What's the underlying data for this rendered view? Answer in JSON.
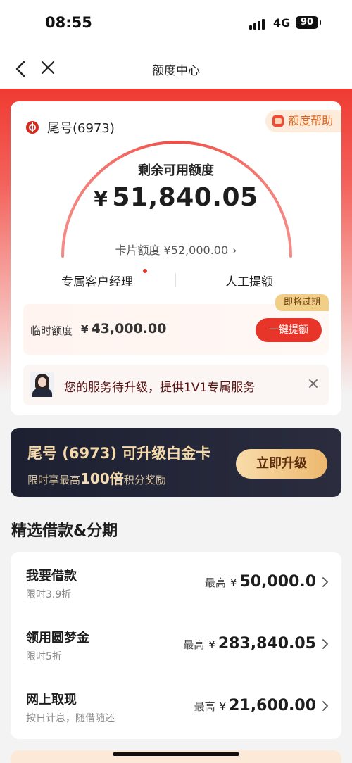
{
  "status_bar": {
    "time": "08:55",
    "network": "4G",
    "battery": "90"
  },
  "nav": {
    "title": "额度中心"
  },
  "card": {
    "tail_label": "尾号(6973)",
    "help_label": "额度帮助",
    "remaining_label": "剩余可用额度",
    "currency": "¥",
    "remaining_amount": "51,840.05",
    "card_limit_text": "卡片额度 ¥52,000.00",
    "links": [
      "专属客户经理",
      "人工提额"
    ],
    "temp_label": "临时额度",
    "temp_amount": "43,000.00",
    "temp_badge": "即将过期",
    "temp_button": "一键提额",
    "service_message": "您的服务待升级，提供1V1专属服务"
  },
  "upgrade": {
    "title": "尾号 (6973) 可升级白金卡",
    "subtitle_pre": "限时享最高",
    "subtitle_em": "100倍",
    "subtitle_post": "积分奖励",
    "button": "立即升级"
  },
  "section": {
    "title": "精选借款&分期",
    "items": [
      {
        "name": "我要借款",
        "sub": "限时3.9折",
        "prefix": "最高",
        "amount": "50,000.0"
      },
      {
        "name": "领用圆梦金",
        "sub": "限时5折",
        "prefix": "最高",
        "amount": "283,840.05"
      },
      {
        "name": "网上取现",
        "sub": "按日计息，随借随还",
        "prefix": "最高",
        "amount": "21,600.00"
      }
    ]
  },
  "colors": {
    "accent": "#e8352a",
    "gold": "#f5d9a8",
    "dark": "#1c2031"
  }
}
